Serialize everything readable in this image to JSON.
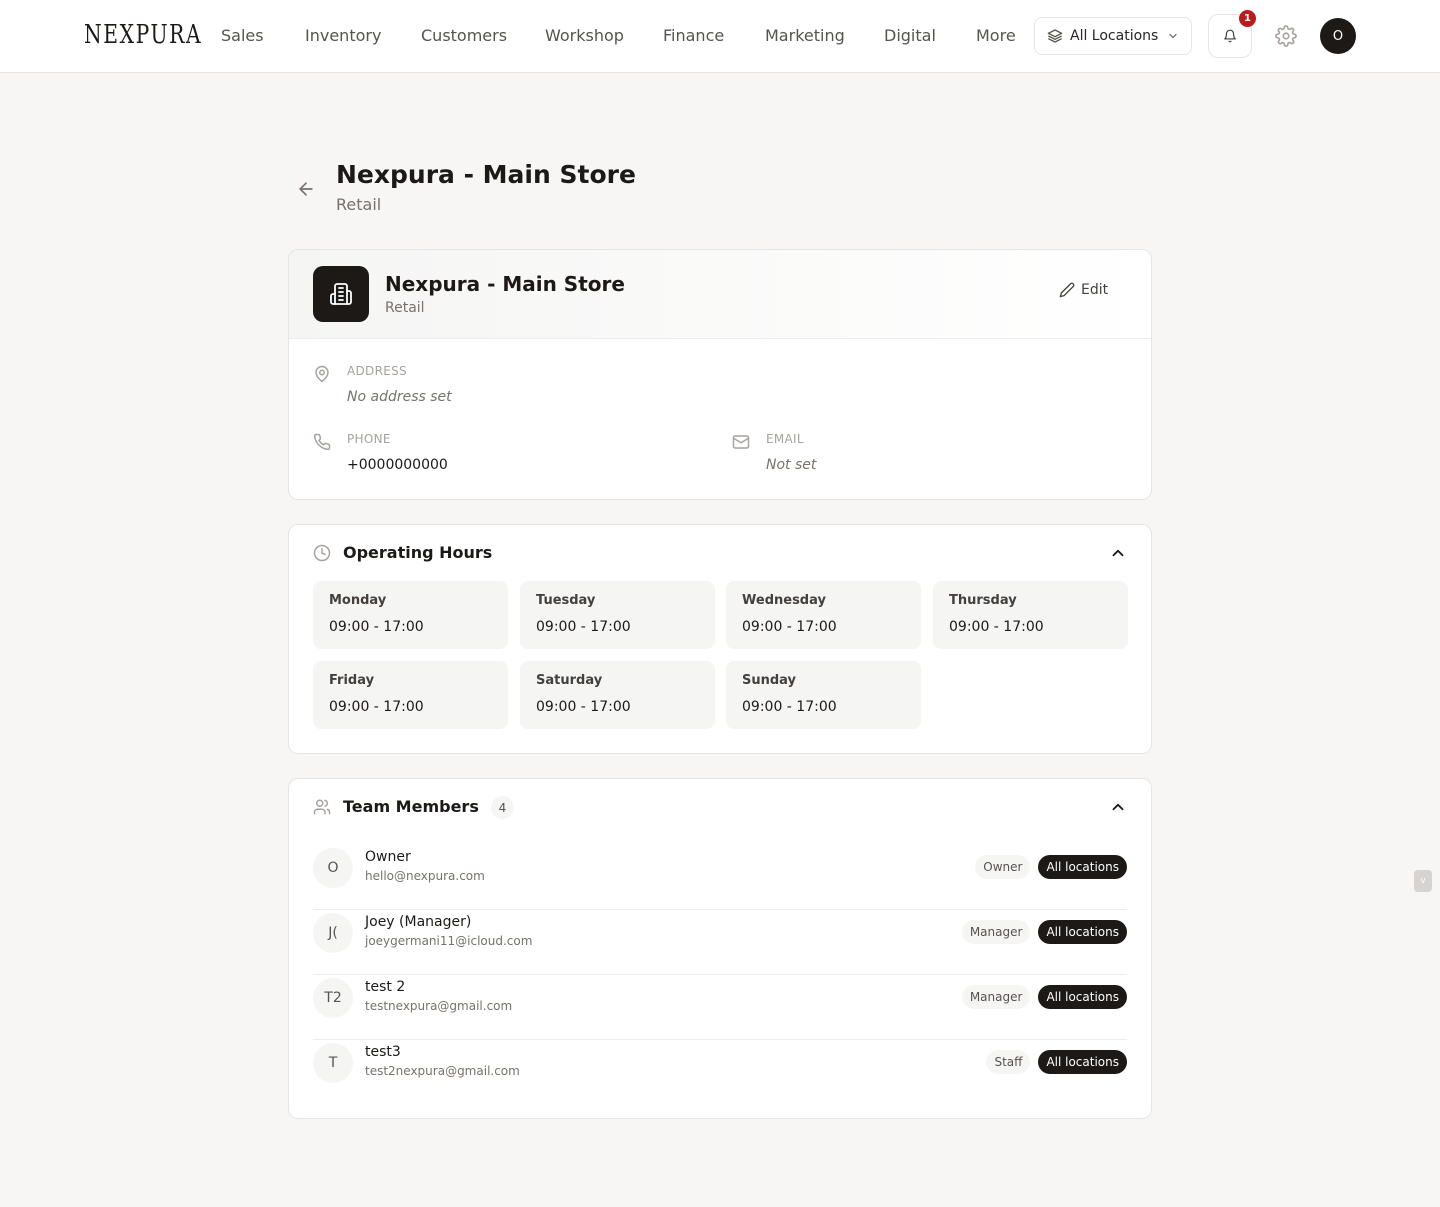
{
  "brand": {
    "logo": "NEXPURA"
  },
  "nav": {
    "items": [
      "Sales",
      "Inventory",
      "Customers",
      "Workshop",
      "Finance",
      "Marketing",
      "Digital",
      "More"
    ],
    "location_select": "All Locations",
    "notifications_count": "1",
    "user_initial": "O"
  },
  "header": {
    "title": "Nexpura - Main Store",
    "subtitle": "Retail"
  },
  "store": {
    "name": "Nexpura - Main Store",
    "type": "Retail",
    "edit_label": "Edit",
    "address": {
      "label": "ADDRESS",
      "value": "No address set"
    },
    "phone": {
      "label": "PHONE",
      "value": "+0000000000"
    },
    "email": {
      "label": "EMAIL",
      "value": "Not set"
    }
  },
  "hours": {
    "title": "Operating Hours",
    "days": [
      {
        "day": "Monday",
        "hours": "09:00 - 17:00"
      },
      {
        "day": "Tuesday",
        "hours": "09:00 - 17:00"
      },
      {
        "day": "Wednesday",
        "hours": "09:00 - 17:00"
      },
      {
        "day": "Thursday",
        "hours": "09:00 - 17:00"
      },
      {
        "day": "Friday",
        "hours": "09:00 - 17:00"
      },
      {
        "day": "Saturday",
        "hours": "09:00 - 17:00"
      },
      {
        "day": "Sunday",
        "hours": "09:00 - 17:00"
      }
    ]
  },
  "team": {
    "title": "Team Members",
    "count": "4",
    "members": [
      {
        "initials": "O",
        "name": "Owner",
        "email": "hello@nexpura.com",
        "role": "Owner",
        "scope": "All locations"
      },
      {
        "initials": "J(",
        "name": "Joey (Manager)",
        "email": "joeygermani11@icloud.com",
        "role": "Manager",
        "scope": "All locations"
      },
      {
        "initials": "T2",
        "name": "test 2",
        "email": "testnexpura@gmail.com",
        "role": "Manager",
        "scope": "All locations"
      },
      {
        "initials": "T",
        "name": "test3",
        "email": "test2nexpura@gmail.com",
        "role": "Staff",
        "scope": "All locations"
      }
    ]
  },
  "side_tab": {
    "label": "v"
  },
  "colors": {
    "accent_dark": "#1c1917",
    "badge_red": "#b91c1c",
    "background": "#f7f6f5"
  }
}
